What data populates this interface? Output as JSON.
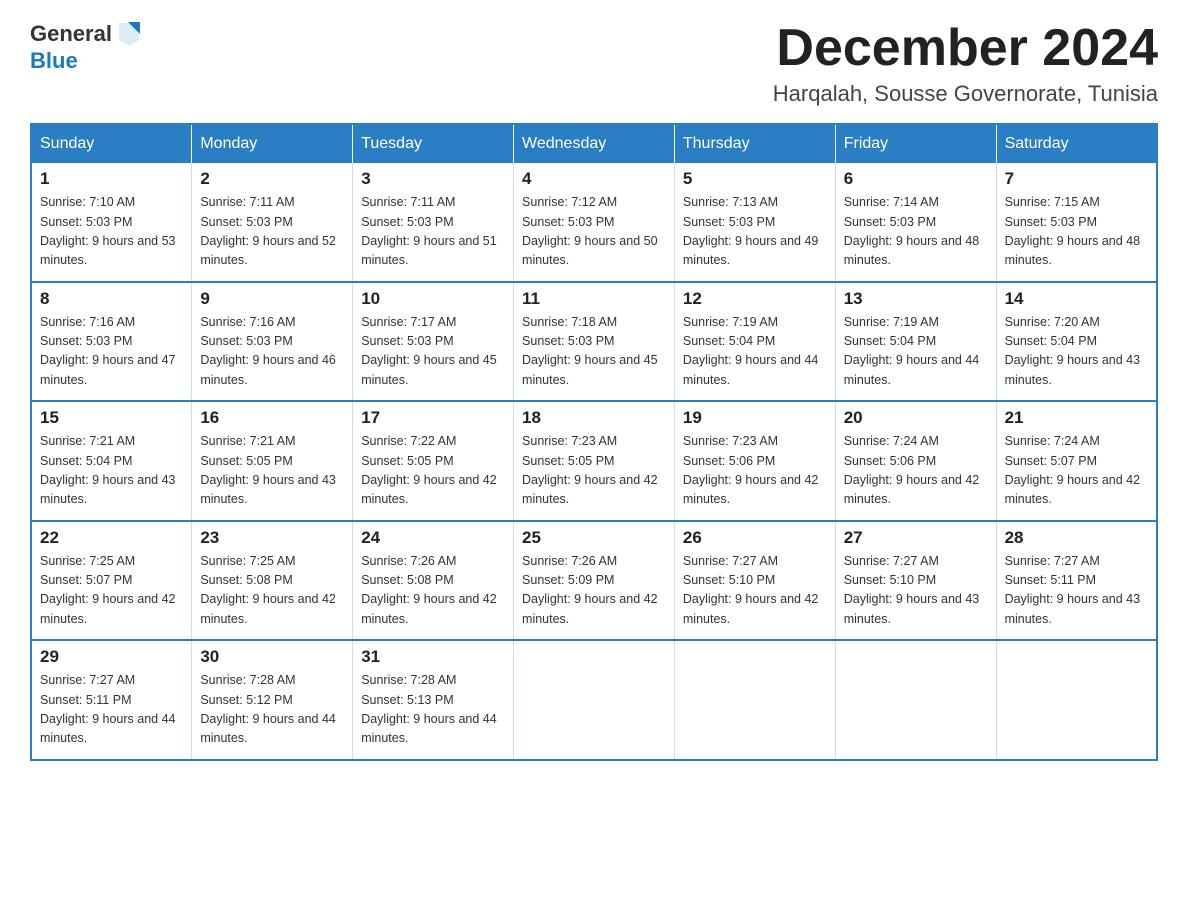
{
  "header": {
    "logo_general": "General",
    "logo_blue": "Blue",
    "month_title": "December 2024",
    "location": "Harqalah, Sousse Governorate, Tunisia"
  },
  "weekdays": [
    "Sunday",
    "Monday",
    "Tuesday",
    "Wednesday",
    "Thursday",
    "Friday",
    "Saturday"
  ],
  "weeks": [
    [
      {
        "day": "1",
        "sunrise": "7:10 AM",
        "sunset": "5:03 PM",
        "daylight": "9 hours and 53 minutes."
      },
      {
        "day": "2",
        "sunrise": "7:11 AM",
        "sunset": "5:03 PM",
        "daylight": "9 hours and 52 minutes."
      },
      {
        "day": "3",
        "sunrise": "7:11 AM",
        "sunset": "5:03 PM",
        "daylight": "9 hours and 51 minutes."
      },
      {
        "day": "4",
        "sunrise": "7:12 AM",
        "sunset": "5:03 PM",
        "daylight": "9 hours and 50 minutes."
      },
      {
        "day": "5",
        "sunrise": "7:13 AM",
        "sunset": "5:03 PM",
        "daylight": "9 hours and 49 minutes."
      },
      {
        "day": "6",
        "sunrise": "7:14 AM",
        "sunset": "5:03 PM",
        "daylight": "9 hours and 48 minutes."
      },
      {
        "day": "7",
        "sunrise": "7:15 AM",
        "sunset": "5:03 PM",
        "daylight": "9 hours and 48 minutes."
      }
    ],
    [
      {
        "day": "8",
        "sunrise": "7:16 AM",
        "sunset": "5:03 PM",
        "daylight": "9 hours and 47 minutes."
      },
      {
        "day": "9",
        "sunrise": "7:16 AM",
        "sunset": "5:03 PM",
        "daylight": "9 hours and 46 minutes."
      },
      {
        "day": "10",
        "sunrise": "7:17 AM",
        "sunset": "5:03 PM",
        "daylight": "9 hours and 45 minutes."
      },
      {
        "day": "11",
        "sunrise": "7:18 AM",
        "sunset": "5:03 PM",
        "daylight": "9 hours and 45 minutes."
      },
      {
        "day": "12",
        "sunrise": "7:19 AM",
        "sunset": "5:04 PM",
        "daylight": "9 hours and 44 minutes."
      },
      {
        "day": "13",
        "sunrise": "7:19 AM",
        "sunset": "5:04 PM",
        "daylight": "9 hours and 44 minutes."
      },
      {
        "day": "14",
        "sunrise": "7:20 AM",
        "sunset": "5:04 PM",
        "daylight": "9 hours and 43 minutes."
      }
    ],
    [
      {
        "day": "15",
        "sunrise": "7:21 AM",
        "sunset": "5:04 PM",
        "daylight": "9 hours and 43 minutes."
      },
      {
        "day": "16",
        "sunrise": "7:21 AM",
        "sunset": "5:05 PM",
        "daylight": "9 hours and 43 minutes."
      },
      {
        "day": "17",
        "sunrise": "7:22 AM",
        "sunset": "5:05 PM",
        "daylight": "9 hours and 42 minutes."
      },
      {
        "day": "18",
        "sunrise": "7:23 AM",
        "sunset": "5:05 PM",
        "daylight": "9 hours and 42 minutes."
      },
      {
        "day": "19",
        "sunrise": "7:23 AM",
        "sunset": "5:06 PM",
        "daylight": "9 hours and 42 minutes."
      },
      {
        "day": "20",
        "sunrise": "7:24 AM",
        "sunset": "5:06 PM",
        "daylight": "9 hours and 42 minutes."
      },
      {
        "day": "21",
        "sunrise": "7:24 AM",
        "sunset": "5:07 PM",
        "daylight": "9 hours and 42 minutes."
      }
    ],
    [
      {
        "day": "22",
        "sunrise": "7:25 AM",
        "sunset": "5:07 PM",
        "daylight": "9 hours and 42 minutes."
      },
      {
        "day": "23",
        "sunrise": "7:25 AM",
        "sunset": "5:08 PM",
        "daylight": "9 hours and 42 minutes."
      },
      {
        "day": "24",
        "sunrise": "7:26 AM",
        "sunset": "5:08 PM",
        "daylight": "9 hours and 42 minutes."
      },
      {
        "day": "25",
        "sunrise": "7:26 AM",
        "sunset": "5:09 PM",
        "daylight": "9 hours and 42 minutes."
      },
      {
        "day": "26",
        "sunrise": "7:27 AM",
        "sunset": "5:10 PM",
        "daylight": "9 hours and 42 minutes."
      },
      {
        "day": "27",
        "sunrise": "7:27 AM",
        "sunset": "5:10 PM",
        "daylight": "9 hours and 43 minutes."
      },
      {
        "day": "28",
        "sunrise": "7:27 AM",
        "sunset": "5:11 PM",
        "daylight": "9 hours and 43 minutes."
      }
    ],
    [
      {
        "day": "29",
        "sunrise": "7:27 AM",
        "sunset": "5:11 PM",
        "daylight": "9 hours and 44 minutes."
      },
      {
        "day": "30",
        "sunrise": "7:28 AM",
        "sunset": "5:12 PM",
        "daylight": "9 hours and 44 minutes."
      },
      {
        "day": "31",
        "sunrise": "7:28 AM",
        "sunset": "5:13 PM",
        "daylight": "9 hours and 44 minutes."
      },
      null,
      null,
      null,
      null
    ]
  ],
  "labels": {
    "sunrise_prefix": "Sunrise: ",
    "sunset_prefix": "Sunset: ",
    "daylight_prefix": "Daylight: "
  }
}
